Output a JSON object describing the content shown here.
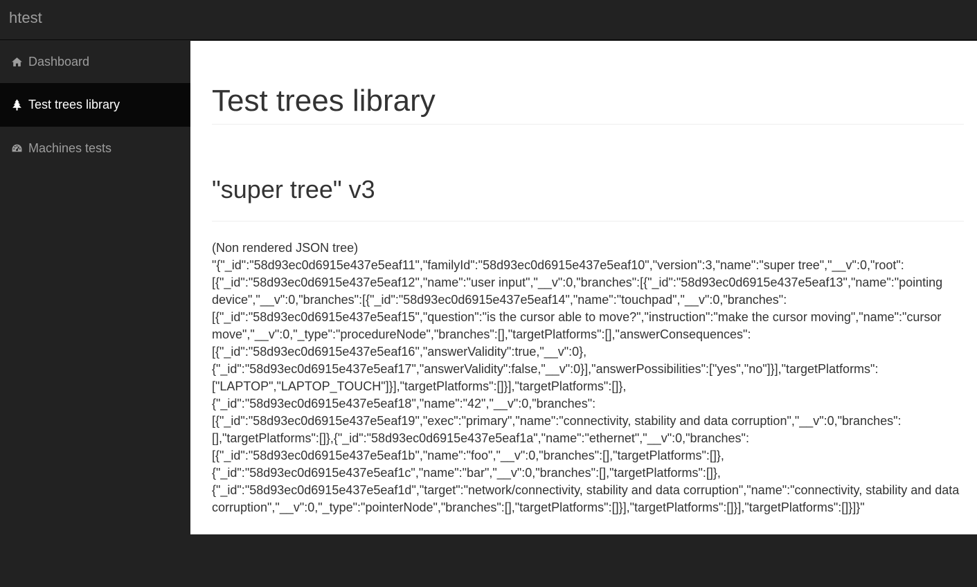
{
  "navbar": {
    "brand": "htest"
  },
  "sidebar": {
    "items": [
      {
        "label": "Dashboard",
        "icon": "home-icon",
        "active": false
      },
      {
        "label": "Test trees library",
        "icon": "tree-icon",
        "active": true
      },
      {
        "label": "Machines tests",
        "icon": "dashboard-gauge-icon",
        "active": false
      }
    ]
  },
  "main": {
    "page_title": "Test trees library",
    "tree_title": "\"super tree\" v3",
    "json_caption": "(Non rendered JSON tree)",
    "json_text": "\"{\"_id\":\"58d93ec0d6915e437e5eaf11\",\"familyId\":\"58d93ec0d6915e437e5eaf10\",\"version\":3,\"name\":\"super tree\",\"__v\":0,\"root\":[{\"_id\":\"58d93ec0d6915e437e5eaf12\",\"name\":\"user input\",\"__v\":0,\"branches\":[{\"_id\":\"58d93ec0d6915e437e5eaf13\",\"name\":\"pointing device\",\"__v\":0,\"branches\":[{\"_id\":\"58d93ec0d6915e437e5eaf14\",\"name\":\"touchpad\",\"__v\":0,\"branches\":[{\"_id\":\"58d93ec0d6915e437e5eaf15\",\"question\":\"is the cursor able to move?\",\"instruction\":\"make the cursor moving\",\"name\":\"cursor move\",\"__v\":0,\"_type\":\"procedureNode\",\"branches\":[],\"targetPlatforms\":[],\"answerConsequences\":[{\"_id\":\"58d93ec0d6915e437e5eaf16\",\"answerValidity\":true,\"__v\":0},{\"_id\":\"58d93ec0d6915e437e5eaf17\",\"answerValidity\":false,\"__v\":0}],\"answerPossibilities\":[\"yes\",\"no\"]}],\"targetPlatforms\":[\"LAPTOP\",\"LAPTOP_TOUCH\"]}],\"targetPlatforms\":[]}],\"targetPlatforms\":[]},{\"_id\":\"58d93ec0d6915e437e5eaf18\",\"name\":\"42\",\"__v\":0,\"branches\":[{\"_id\":\"58d93ec0d6915e437e5eaf19\",\"exec\":\"primary\",\"name\":\"connectivity, stability and data corruption\",\"__v\":0,\"branches\":[],\"targetPlatforms\":[]},{\"_id\":\"58d93ec0d6915e437e5eaf1a\",\"name\":\"ethernet\",\"__v\":0,\"branches\":[{\"_id\":\"58d93ec0d6915e437e5eaf1b\",\"name\":\"foo\",\"__v\":0,\"branches\":[],\"targetPlatforms\":[]},{\"_id\":\"58d93ec0d6915e437e5eaf1c\",\"name\":\"bar\",\"__v\":0,\"branches\":[],\"targetPlatforms\":[]},{\"_id\":\"58d93ec0d6915e437e5eaf1d\",\"target\":\"network/connectivity, stability and data corruption\",\"name\":\"connectivity, stability and data corruption\",\"__v\":0,\"_type\":\"pointerNode\",\"branches\":[],\"targetPlatforms\":[]}],\"targetPlatforms\":[]}],\"targetPlatforms\":[]}]}\""
  },
  "colors": {
    "navbar_bg": "#222222",
    "active_item_bg": "#080808",
    "nav_text": "#9d9d9d",
    "active_text": "#ffffff",
    "content_bg": "#ffffff",
    "content_text": "#333333"
  }
}
